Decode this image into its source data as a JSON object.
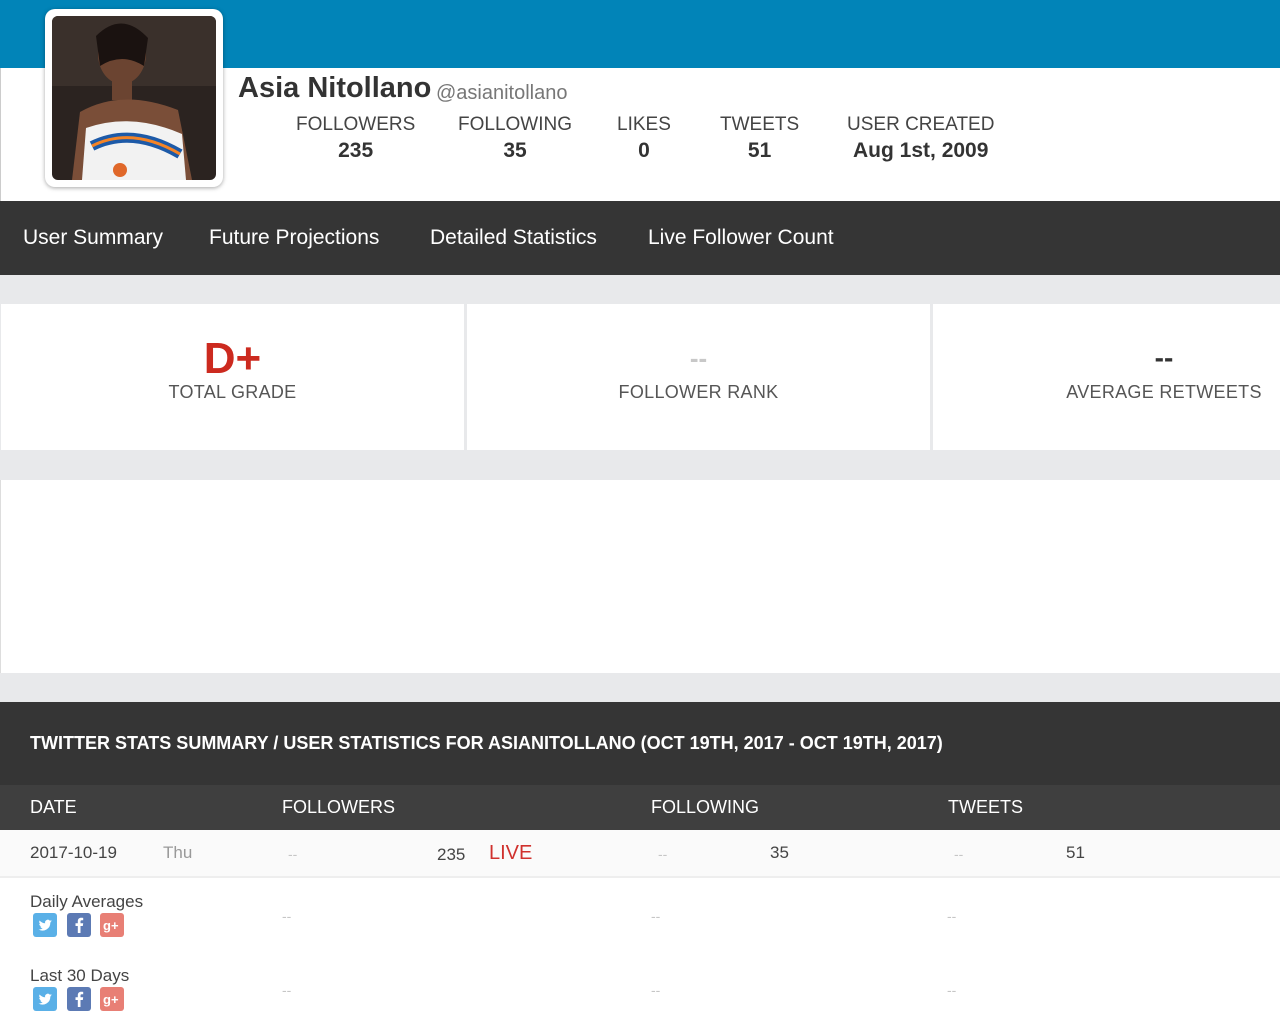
{
  "profile": {
    "name": "Asia Nitollano",
    "handle": "@asianitollano",
    "avatar_alt": "profile photo",
    "stats": [
      {
        "label": "FOLLOWERS",
        "value": "235"
      },
      {
        "label": "FOLLOWING",
        "value": "35"
      },
      {
        "label": "LIKES",
        "value": "0"
      },
      {
        "label": "TWEETS",
        "value": "51"
      },
      {
        "label": "USER CREATED",
        "value": "Aug 1st, 2009"
      }
    ]
  },
  "nav": {
    "items": [
      {
        "label": "User Summary"
      },
      {
        "label": "Future Projections"
      },
      {
        "label": "Detailed Statistics"
      },
      {
        "label": "Live Follower Count"
      }
    ]
  },
  "cards": [
    {
      "value": "D+",
      "label": "TOTAL GRADE",
      "color": "#cc2a1f"
    },
    {
      "value": "--",
      "label": "FOLLOWER RANK",
      "color": "#c8c8c8"
    },
    {
      "value": "--",
      "label": "AVERAGE RETWEETS",
      "color": "#333333"
    }
  ],
  "summary": {
    "title": "TWITTER STATS SUMMARY / USER STATISTICS FOR ASIANITOLLANO (OCT 19TH, 2017 - OCT 19TH, 2017)",
    "columns": [
      "DATE",
      "FOLLOWERS",
      "FOLLOWING",
      "TWEETS"
    ],
    "rows": [
      {
        "date": "2017-10-19",
        "day": "Thu",
        "followers_change": "--",
        "followers": "235",
        "live": "LIVE",
        "following_change": "--",
        "following": "35",
        "tweets_change": "--",
        "tweets": "51"
      }
    ],
    "averages": [
      {
        "label": "Daily Averages",
        "followers": "--",
        "following": "--",
        "tweets": "--"
      },
      {
        "label": "Last 30 Days",
        "followers": "--",
        "following": "--",
        "tweets": "--"
      }
    ]
  },
  "colors": {
    "topbar": "#0184b8",
    "nav": "#353535",
    "live": "#d0312d",
    "grade": "#cc2a1f"
  },
  "icons": [
    "twitter-icon",
    "facebook-icon",
    "google-plus-icon"
  ]
}
